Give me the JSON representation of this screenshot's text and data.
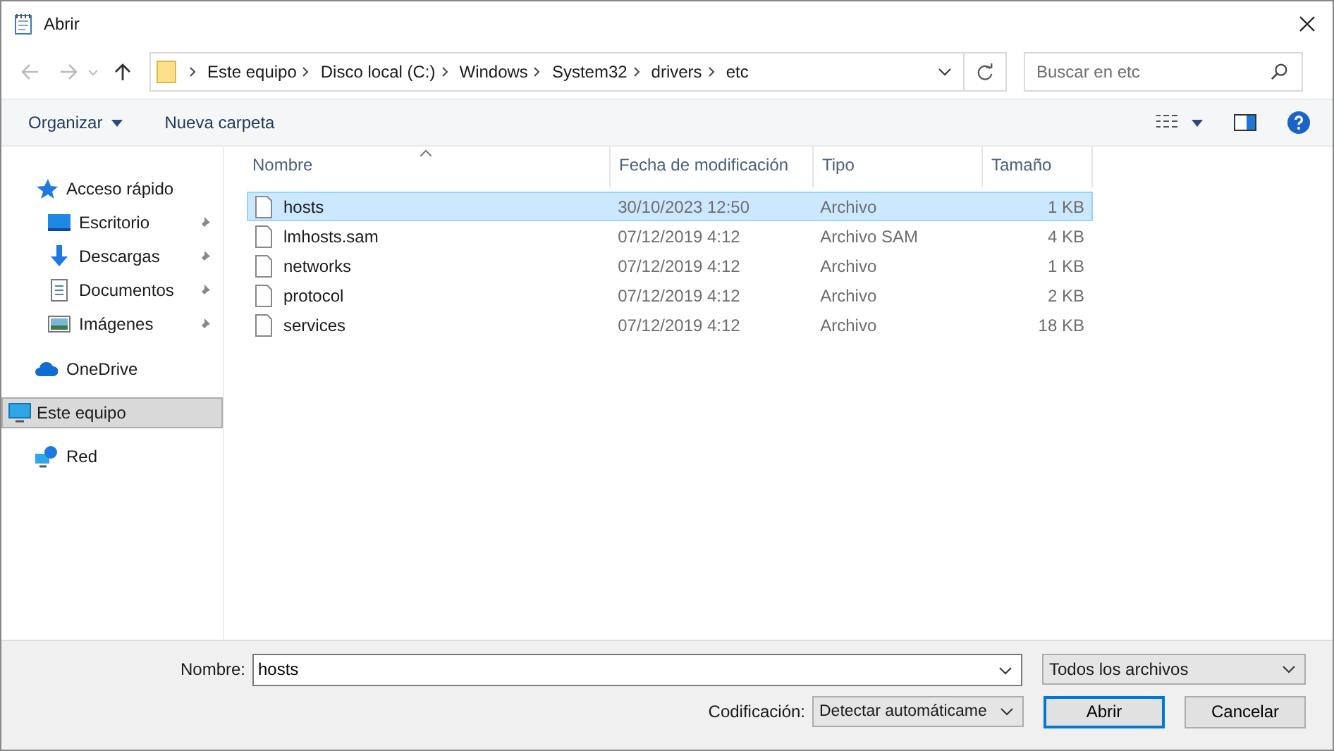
{
  "window": {
    "title": "Abrir"
  },
  "address_bar": {
    "segments": [
      "Este equipo",
      "Disco local (C:)",
      "Windows",
      "System32",
      "drivers",
      "etc"
    ]
  },
  "search": {
    "placeholder": "Buscar en etc"
  },
  "toolbar": {
    "organize": "Organizar",
    "new_folder": "Nueva carpeta"
  },
  "sidebar": {
    "items": [
      {
        "label": "Acceso rápido",
        "kind": "star",
        "selected": false,
        "children": [
          {
            "label": "Escritorio",
            "kind": "desktop",
            "selected": false
          },
          {
            "label": "Descargas",
            "kind": "download",
            "selected": false
          },
          {
            "label": "Documentos",
            "kind": "document",
            "selected": false
          },
          {
            "label": "Imágenes",
            "kind": "pictures",
            "selected": false
          }
        ]
      },
      {
        "label": "OneDrive",
        "kind": "cloud",
        "selected": false
      },
      {
        "label": "Este equipo",
        "kind": "computer",
        "selected": true
      },
      {
        "label": "Red",
        "kind": "network",
        "selected": false
      }
    ]
  },
  "table": {
    "columns": [
      "Nombre",
      "Fecha de modificación",
      "Tipo",
      "Tamaño"
    ],
    "rows": [
      {
        "name": "hosts",
        "date": "30/10/2023 12:50",
        "type": "Archivo",
        "size": "1 KB",
        "selected": true
      },
      {
        "name": "lmhosts.sam",
        "date": "07/12/2019 4:12",
        "type": "Archivo SAM",
        "size": "4 KB",
        "selected": false
      },
      {
        "name": "networks",
        "date": "07/12/2019 4:12",
        "type": "Archivo",
        "size": "1 KB",
        "selected": false
      },
      {
        "name": "protocol",
        "date": "07/12/2019 4:12",
        "type": "Archivo",
        "size": "2 KB",
        "selected": false
      },
      {
        "name": "services",
        "date": "07/12/2019 4:12",
        "type": "Archivo",
        "size": "18 KB",
        "selected": false
      }
    ]
  },
  "footer": {
    "name_label": "Nombre:",
    "name_value": "hosts",
    "filter": "Todos los archivos",
    "encoding_label": "Codificación:",
    "encoding": "Detectar automáticame",
    "buttons": [
      "Abrir",
      "Cancelar"
    ]
  }
}
